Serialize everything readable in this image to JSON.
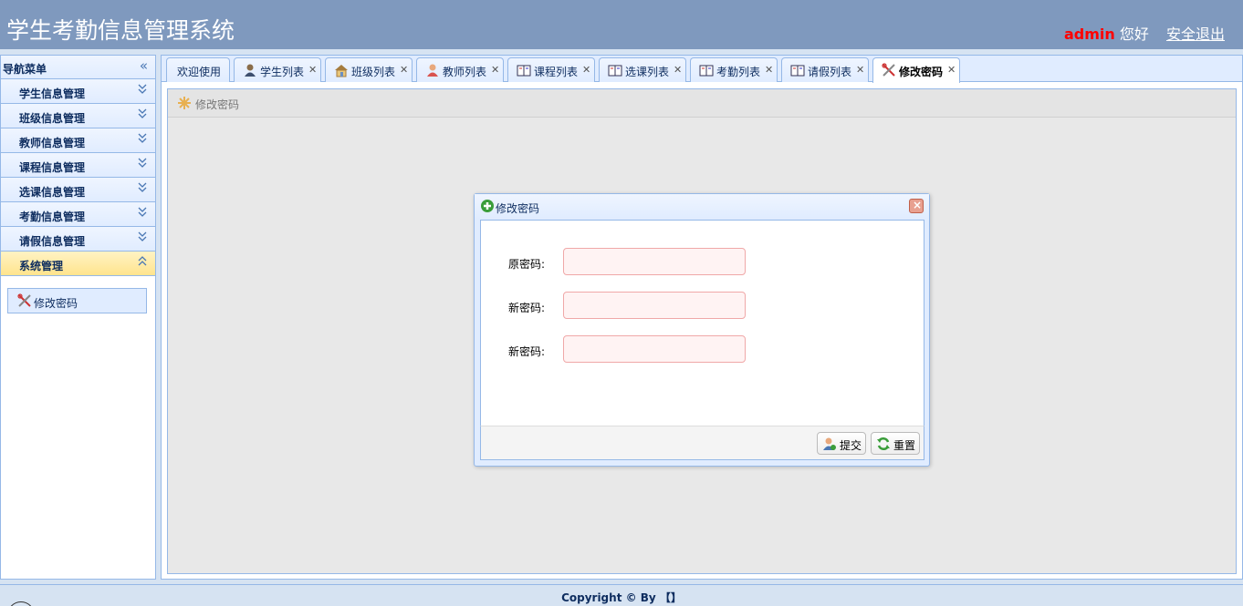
{
  "header": {
    "title": "学生考勤信息管理系统",
    "username": "admin",
    "greeting": "您好",
    "logout": "安全退出"
  },
  "sidebar": {
    "title": "导航菜单",
    "items": [
      {
        "label": "学生信息管理"
      },
      {
        "label": "班级信息管理"
      },
      {
        "label": "教师信息管理"
      },
      {
        "label": "课程信息管理"
      },
      {
        "label": "选课信息管理"
      },
      {
        "label": "考勤信息管理"
      },
      {
        "label": "请假信息管理"
      },
      {
        "label": "系统管理"
      }
    ],
    "submenu": {
      "label": "修改密码"
    }
  },
  "tabs": [
    {
      "label": "欢迎使用",
      "icon": "none"
    },
    {
      "label": "学生列表",
      "icon": "user-icon"
    },
    {
      "label": "班级列表",
      "icon": "house-icon"
    },
    {
      "label": "教师列表",
      "icon": "person-icon"
    },
    {
      "label": "课程列表",
      "icon": "book-icon"
    },
    {
      "label": "选课列表",
      "icon": "book-icon"
    },
    {
      "label": "考勤列表",
      "icon": "book-icon"
    },
    {
      "label": "请假列表",
      "icon": "book-icon"
    },
    {
      "label": "修改密码",
      "icon": "tools-icon"
    }
  ],
  "toolbar": {
    "label": "修改密码"
  },
  "dialog": {
    "title": "修改密码",
    "fields": [
      {
        "label": "原密码:",
        "value": ""
      },
      {
        "label": "新密码:",
        "value": ""
      },
      {
        "label": "新密码:",
        "value": ""
      }
    ],
    "submit_label": "提交",
    "reset_label": "重置"
  },
  "footer": {
    "text": "Copyright © By 【】"
  },
  "colors": {
    "header_bg": "#7f99be",
    "accent_border": "#95b8e7",
    "active_menu": "#ffe48d",
    "username": "#ff0000"
  }
}
